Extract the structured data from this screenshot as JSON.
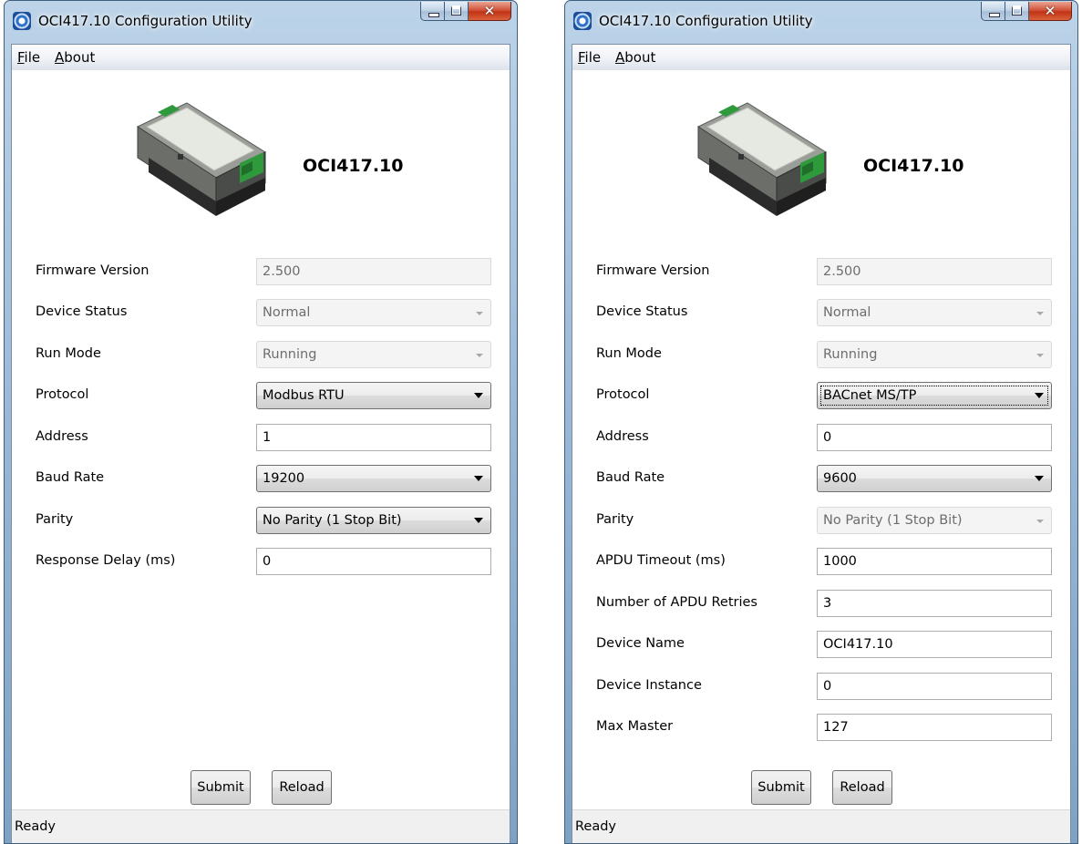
{
  "left": {
    "window": {
      "title": "OCI417.10 Configuration Utility"
    },
    "menu": {
      "file": "File",
      "about": "About"
    },
    "device_title": "OCI417.10",
    "fields": [
      {
        "label": "Firmware Version",
        "value": "2.500",
        "kind": "text-disabled"
      },
      {
        "label": "Device Status",
        "value": "Normal",
        "kind": "combo-disabled"
      },
      {
        "label": "Run Mode",
        "value": "Running",
        "kind": "combo-disabled"
      },
      {
        "label": "Protocol",
        "value": "Modbus RTU",
        "kind": "combo"
      },
      {
        "label": "Address",
        "value": "1",
        "kind": "text"
      },
      {
        "label": "Baud Rate",
        "value": "19200",
        "kind": "combo"
      },
      {
        "label": "Parity",
        "value": "No Parity (1 Stop Bit)",
        "kind": "combo"
      },
      {
        "label": "Response Delay (ms)",
        "value": "0",
        "kind": "text"
      }
    ],
    "buttons": {
      "submit": "Submit",
      "reload": "Reload"
    },
    "status": "Ready"
  },
  "right": {
    "window": {
      "title": "OCI417.10 Configuration Utility"
    },
    "menu": {
      "file": "File",
      "about": "About"
    },
    "device_title": "OCI417.10",
    "fields": [
      {
        "label": "Firmware Version",
        "value": "2.500",
        "kind": "text-disabled"
      },
      {
        "label": "Device Status",
        "value": "Normal",
        "kind": "combo-disabled"
      },
      {
        "label": "Run Mode",
        "value": "Running",
        "kind": "combo-disabled"
      },
      {
        "label": "Protocol",
        "value": "BACnet MS/TP",
        "kind": "combo-focused"
      },
      {
        "label": "Address",
        "value": "0",
        "kind": "text"
      },
      {
        "label": "Baud Rate",
        "value": "9600",
        "kind": "combo"
      },
      {
        "label": "Parity",
        "value": "No Parity (1 Stop Bit)",
        "kind": "combo-disabled"
      },
      {
        "label": "APDU Timeout (ms)",
        "value": "1000",
        "kind": "text"
      },
      {
        "label": "Number of APDU Retries",
        "value": "3",
        "kind": "text"
      },
      {
        "label": "Device Name",
        "value": "OCI417.10",
        "kind": "text"
      },
      {
        "label": "Device Instance",
        "value": "0",
        "kind": "text"
      },
      {
        "label": "Max Master",
        "value": "127",
        "kind": "text"
      }
    ],
    "buttons": {
      "submit": "Submit",
      "reload": "Reload"
    },
    "status": "Ready"
  },
  "icons": {
    "app": "app-icon",
    "minimize": "minimize-icon",
    "maximize": "maximize-icon",
    "close": "close-icon",
    "dropdown": "chevron-down-icon",
    "device": "device-image"
  },
  "colors": {
    "frame": "#9ab8d6",
    "close_button": "#c8432a",
    "disabled_text": "#6d6d6d"
  }
}
